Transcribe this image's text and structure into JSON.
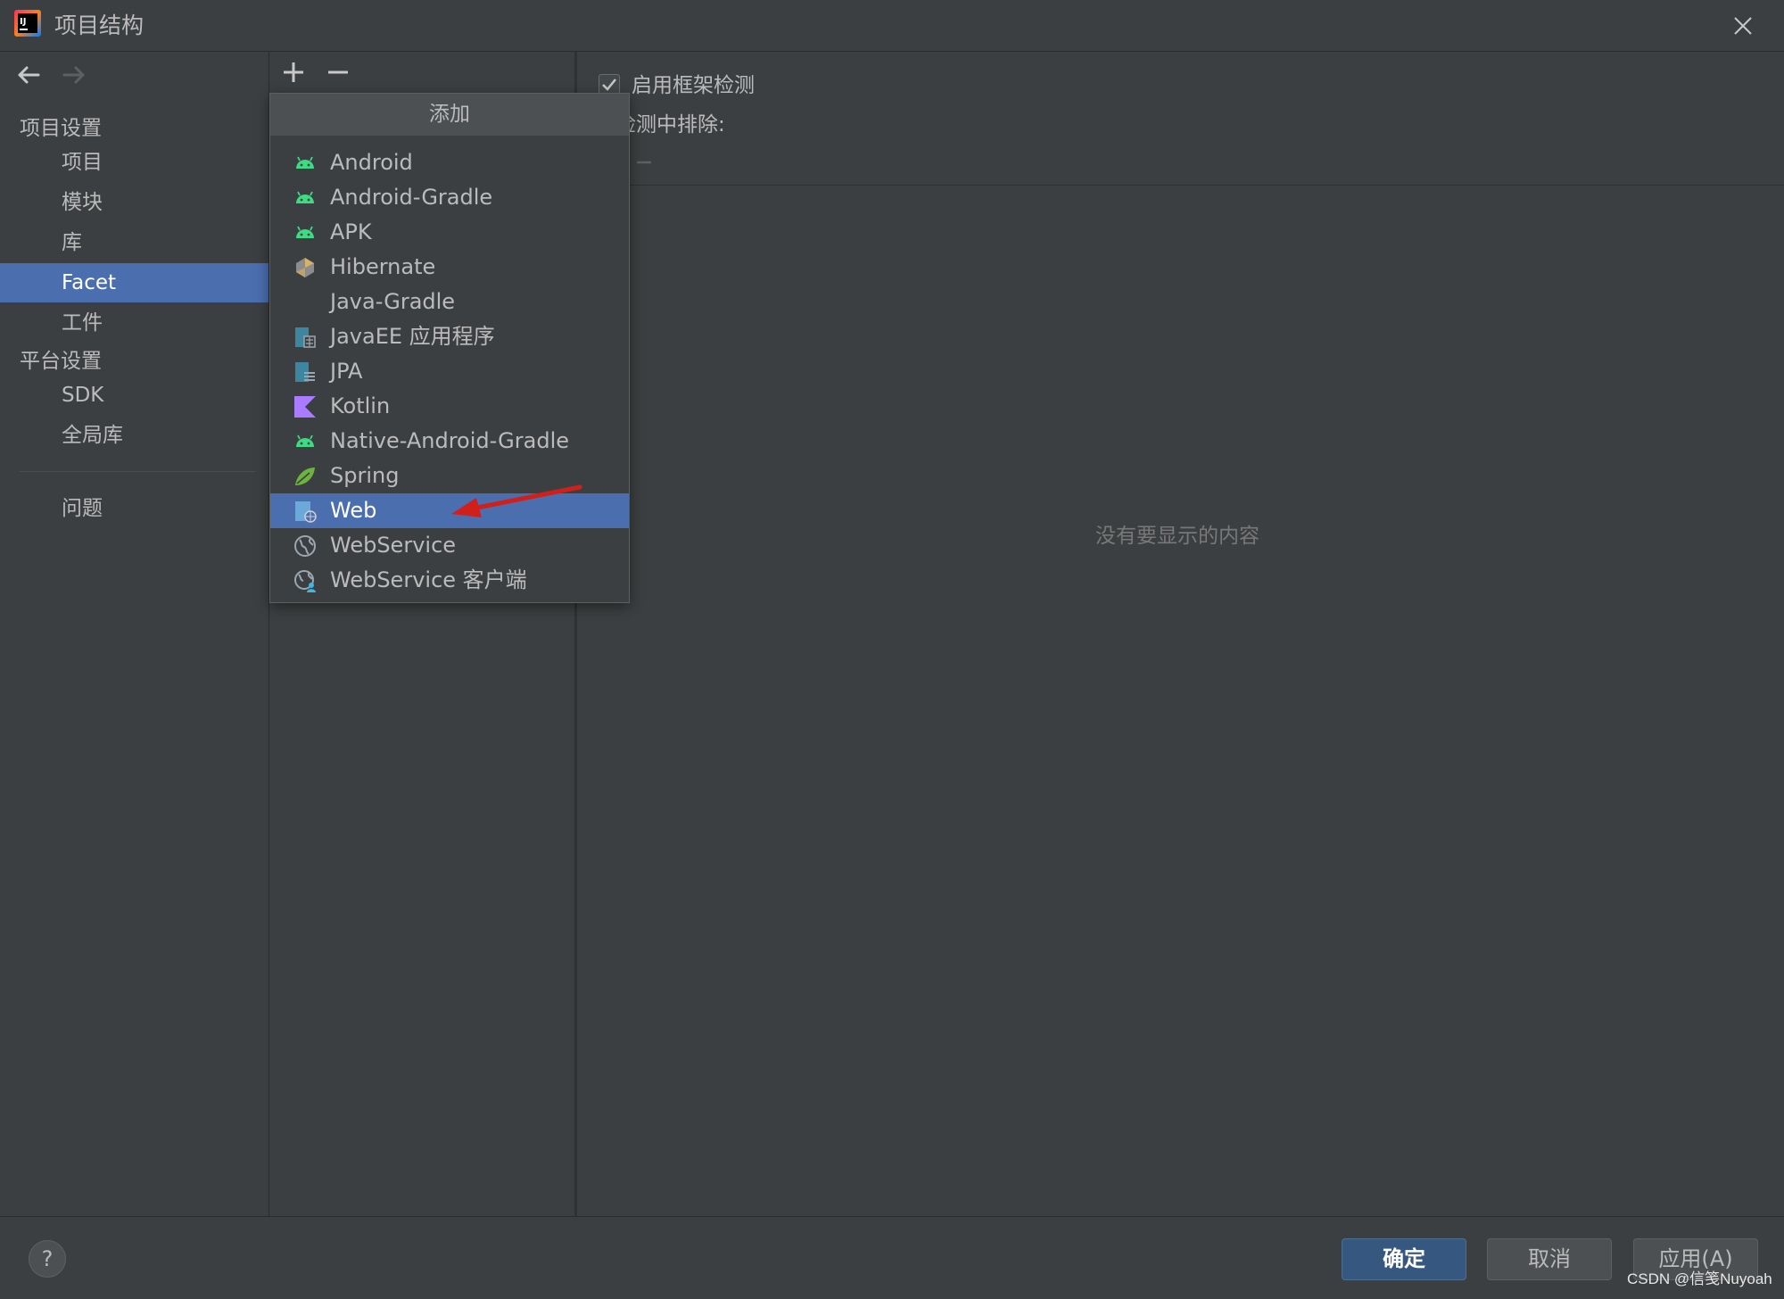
{
  "window": {
    "title": "项目结构"
  },
  "nav": {
    "project_settings_header": "项目设置",
    "project_items": [
      {
        "label": "项目"
      },
      {
        "label": "模块"
      },
      {
        "label": "库"
      },
      {
        "label": "Facet"
      },
      {
        "label": "工件"
      }
    ],
    "platform_settings_header": "平台设置",
    "platform_items": [
      {
        "label": "SDK"
      },
      {
        "label": "全局库"
      }
    ],
    "problems_label": "问题",
    "selected": "Facet"
  },
  "toolbar": {
    "add_symbol": "+",
    "remove_symbol": "−"
  },
  "popup": {
    "header": "添加",
    "items": [
      {
        "label": "Android",
        "icon": "android-icon"
      },
      {
        "label": "Android-Gradle",
        "icon": "android-icon"
      },
      {
        "label": "APK",
        "icon": "android-icon"
      },
      {
        "label": "Hibernate",
        "icon": "hibernate-icon"
      },
      {
        "label": "Java-Gradle",
        "icon": ""
      },
      {
        "label": "JavaEE 应用程序",
        "icon": "javaee-icon"
      },
      {
        "label": "JPA",
        "icon": "jpa-icon"
      },
      {
        "label": "Kotlin",
        "icon": "kotlin-icon"
      },
      {
        "label": "Native-Android-Gradle",
        "icon": "android-icon"
      },
      {
        "label": "Spring",
        "icon": "spring-leaf-icon"
      },
      {
        "label": "Web",
        "icon": "web-icon"
      },
      {
        "label": "WebService",
        "icon": "globe-icon"
      },
      {
        "label": "WebService 客户端",
        "icon": "globe-user-icon"
      }
    ],
    "selected": "Web"
  },
  "detail": {
    "detect_label": "启用框架检测",
    "detect_checked": true,
    "exclude_label": "检测中排除:",
    "empty_text": "没有要显示的内容"
  },
  "buttons": {
    "help": "?",
    "ok": "确定",
    "cancel": "取消",
    "apply": "应用(A)"
  },
  "watermark": "CSDN @信笺Nuyoah",
  "colors": {
    "background": "#3c3f41",
    "selection": "#4b6eaf",
    "primary_button": "#365880",
    "android_green": "#3ddc84",
    "annotation_red": "#d0201b"
  }
}
